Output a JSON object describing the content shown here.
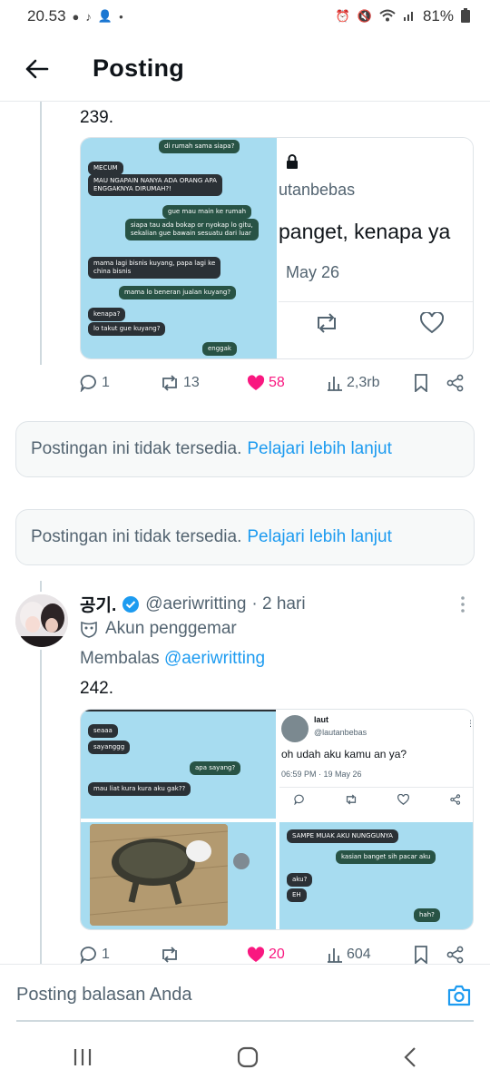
{
  "status_bar": {
    "time": "20.53",
    "battery": "81%"
  },
  "header": {
    "title": "Posting"
  },
  "post1": {
    "text": "239.",
    "chat_bubbles": [
      "di rumah sama siapa?",
      "MECUM",
      "MAU NGAPAIN NANYA ADA ORANG APA\nENGGAKNYA DIRUMAH?!",
      "gue mau main ke rumah",
      "siapa tau ada bokap or nyokap lo gitu,\nsekalian gue bawain sesuatu dari luar",
      "mama lagi bisnis kuyang, papa lagi ke\nchina bisnis",
      "mama lo beneran jualan kuyang?",
      "kenapa?",
      "lo takut gue kuyang?",
      "enggak"
    ],
    "quote": {
      "handle": "utanbebas",
      "text": "panget, kenapa ya",
      "date": "May 26"
    },
    "stats": {
      "replies": "1",
      "reposts": "13",
      "likes": "58",
      "views": "2,3rb"
    }
  },
  "unavailable": {
    "text": "Postingan ini tidak tersedia.",
    "link": "Pelajari lebih lanjut"
  },
  "post2": {
    "author": "공기.",
    "handle": "@aeriwritting",
    "time": "· 2 hari",
    "label": "Akun penggemar",
    "reply_prefix": "Membalas",
    "reply_to": "@aeriwritting",
    "text": "242.",
    "chat_a": [
      "seaaa",
      "sayanggg",
      "apa sayang?",
      "mau liat kura kura aku gak??"
    ],
    "quote": {
      "name": "laut",
      "handle": "@lautanbebas",
      "text": "oh udah aku kamu an ya?",
      "date": "06:59 PM · 19 May 26"
    },
    "chat_b": [
      "SAMPE MUAK AKU NUNGGUNYA",
      "kasian banget sih pacar aku",
      "aku?",
      "EH",
      "hah?"
    ],
    "stats": {
      "replies": "1",
      "reposts": "",
      "likes": "20",
      "views": "604"
    }
  },
  "reply_bar": {
    "placeholder": "Posting balasan Anda"
  },
  "colors": {
    "accent": "#1d9bf0",
    "like": "#f91880",
    "chat_bg": "#a7dcf0"
  }
}
